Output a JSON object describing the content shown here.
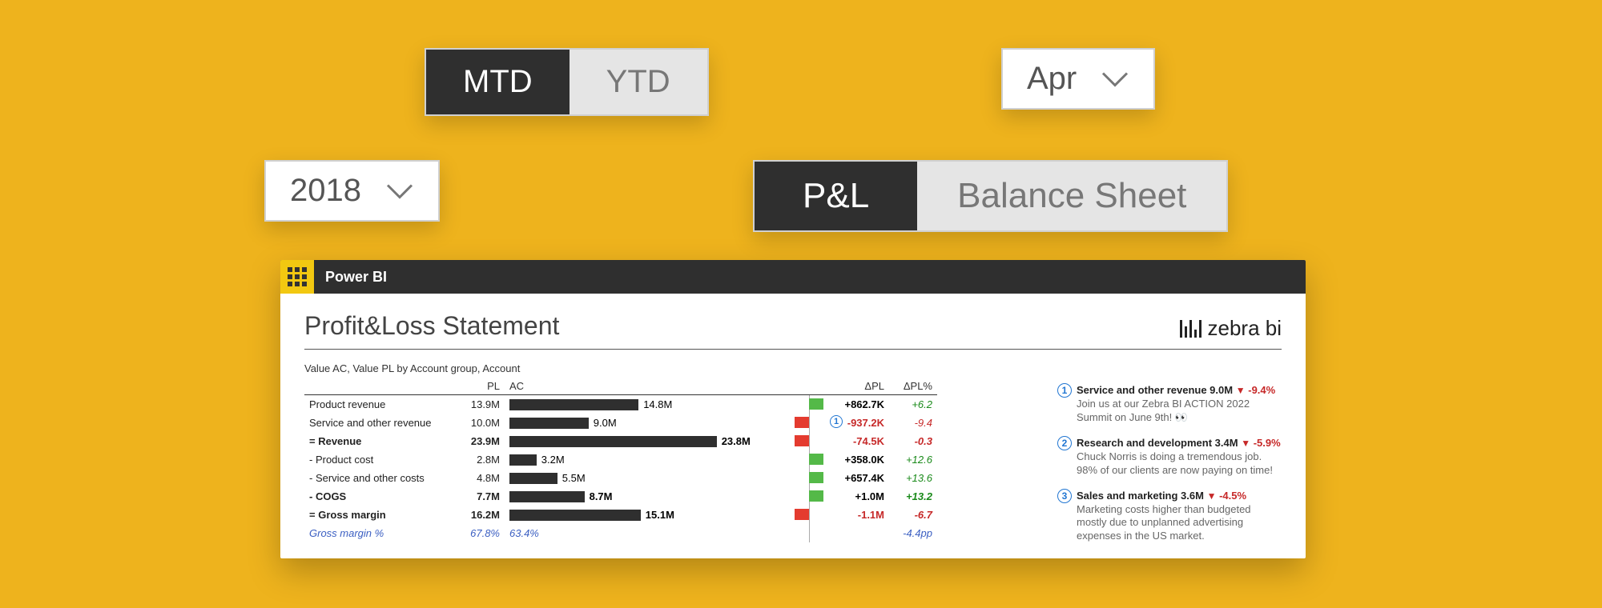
{
  "slicers": {
    "period": {
      "options": [
        "MTD",
        "YTD"
      ],
      "active": "MTD"
    },
    "month": {
      "value": "Apr"
    },
    "year": {
      "value": "2018"
    },
    "sheet": {
      "options": [
        "P&L",
        "Balance Sheet"
      ],
      "active": "P&L"
    }
  },
  "powerbi": {
    "app_name": "Power BI",
    "report_title": "Profit&Loss Statement",
    "brand": "zebra bi",
    "subtitle": "Value AC, Value PL by Account group, Account",
    "columns": {
      "pl": "PL",
      "ac": "AC",
      "dpl": "ΔPL",
      "dplpct": "ΔPL%"
    }
  },
  "chart_data": {
    "type": "table",
    "rows": [
      {
        "label": "Product revenue",
        "pl": "13.9M",
        "ac": "14.8M",
        "dpl": "+862.7K",
        "dplpct": "+6.2",
        "bold": false,
        "sign": "pos",
        "bar_pl": 0.58,
        "bar_ac": 0.62
      },
      {
        "label": "Service and other revenue",
        "pl": "10.0M",
        "ac": "9.0M",
        "dpl": "-937.2K",
        "dplpct": "-9.4",
        "bold": false,
        "sign": "neg",
        "bar_pl": 0.42,
        "bar_ac": 0.38,
        "badge": 1
      },
      {
        "label": "= Revenue",
        "pl": "23.9M",
        "ac": "23.8M",
        "dpl": "-74.5K",
        "dplpct": "-0.3",
        "bold": true,
        "sign": "neg",
        "bar_pl": 1.0,
        "bar_ac": 0.995
      },
      {
        "label": "- Product cost",
        "pl": "2.8M",
        "ac": "3.2M",
        "dpl": "+358.0K",
        "dplpct": "+12.6",
        "bold": false,
        "sign": "pos",
        "bar_pl": 0.12,
        "bar_ac": 0.13
      },
      {
        "label": "- Service and other costs",
        "pl": "4.8M",
        "ac": "5.5M",
        "dpl": "+657.4K",
        "dplpct": "+13.6",
        "bold": false,
        "sign": "pos",
        "bar_pl": 0.2,
        "bar_ac": 0.23
      },
      {
        "label": "- COGS",
        "pl": "7.7M",
        "ac": "8.7M",
        "dpl": "+1.0M",
        "dplpct": "+13.2",
        "bold": true,
        "sign": "pos",
        "bar_pl": 0.32,
        "bar_ac": 0.36
      },
      {
        "label": "= Gross margin",
        "pl": "16.2M",
        "ac": "15.1M",
        "dpl": "-1.1M",
        "dplpct": "-6.7",
        "bold": true,
        "sign": "neg",
        "bar_pl": 0.68,
        "bar_ac": 0.63
      },
      {
        "label": "Gross margin %",
        "pl": "67.8%",
        "ac": "63.4%",
        "dpl": "",
        "dplpct": "-4.4pp",
        "bold": false,
        "sign": "neg",
        "italic": true
      }
    ]
  },
  "annotations": [
    {
      "n": 1,
      "title": "Service and other revenue 9.0M",
      "delta": "-9.4%",
      "dir": "down",
      "body": "Join us at our Zebra BI ACTION 2022 Summit on June 9th! 👀"
    },
    {
      "n": 2,
      "title": "Research and development 3.4M",
      "delta": "-5.9%",
      "dir": "down",
      "body": "Chuck Norris is doing a tremendous job. 98% of our clients are now paying on time!"
    },
    {
      "n": 3,
      "title": "Sales and marketing 3.6M",
      "delta": "-4.5%",
      "dir": "down",
      "body": "Marketing costs higher than budgeted mostly due to unplanned advertising expenses in the US market."
    }
  ]
}
